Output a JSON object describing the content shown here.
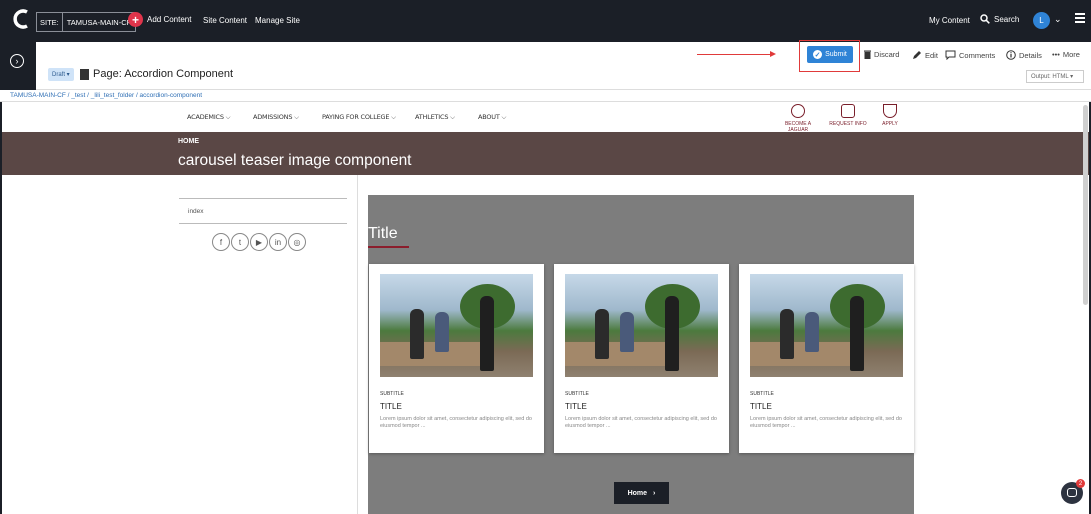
{
  "topbar": {
    "site_label": "SITE:",
    "site_value": "TAMUSA-MAIN-CF",
    "add_content": "Add Content",
    "site_content": "Site Content",
    "manage_site": "Manage Site",
    "my_content": "My Content",
    "search": "Search",
    "avatar_initial": "L"
  },
  "subheader": {
    "draft": "Draft ▾",
    "page_title": "Page: Accordion Component",
    "submit": "Submit",
    "discard": "Discard",
    "edit": "Edit",
    "comments": "Comments",
    "details": "Details",
    "more": "More",
    "output": "Output: HTML ▾"
  },
  "breadcrumb": "TAMUSA-MAIN-CF / _test / _lili_test_folder / accordion-component",
  "site": {
    "nav": [
      "ACADEMICS ⌵",
      "ADMISSIONS ⌵",
      "PAYING FOR COLLEGE ⌵",
      "ATHLETICS ⌵",
      "ABOUT ⌵"
    ],
    "ctas": [
      "BECOME A JAGUAR",
      "REQUEST INFO",
      "APPLY"
    ],
    "hero_home": "HOME",
    "hero_title": "carousel teaser image component",
    "index_label": "index",
    "socials": [
      "f",
      "t",
      "▶",
      "in",
      "◎"
    ],
    "carousel_title": "Title",
    "cards": [
      {
        "subtitle": "SUBTITLE",
        "title": "TITLE",
        "body": "Lorem ipsum dolor sit amet, consectetur adipiscing elit, sed do eiusmod tempor ..."
      },
      {
        "subtitle": "SUBTITLE",
        "title": "TITLE",
        "body": "Lorem ipsum dolor sit amet, consectetur adipiscing elit, sed do eiusmod tempor ..."
      },
      {
        "subtitle": "SUBTITLE",
        "title": "TITLE",
        "body": "Lorem ipsum dolor sit amet, consectetur adipiscing elit, sed do eiusmod tempor ..."
      }
    ],
    "home_button": "Home",
    "home_chevron": "›"
  },
  "chat_badge": "2",
  "colors": {
    "topbar": "#1b1f27",
    "accent_blue": "#2f83d6",
    "add_red": "#e0344b",
    "hero_brown": "#5a4745",
    "maroon": "#8b1d2c",
    "carousel_gray": "#7d7d7d"
  }
}
